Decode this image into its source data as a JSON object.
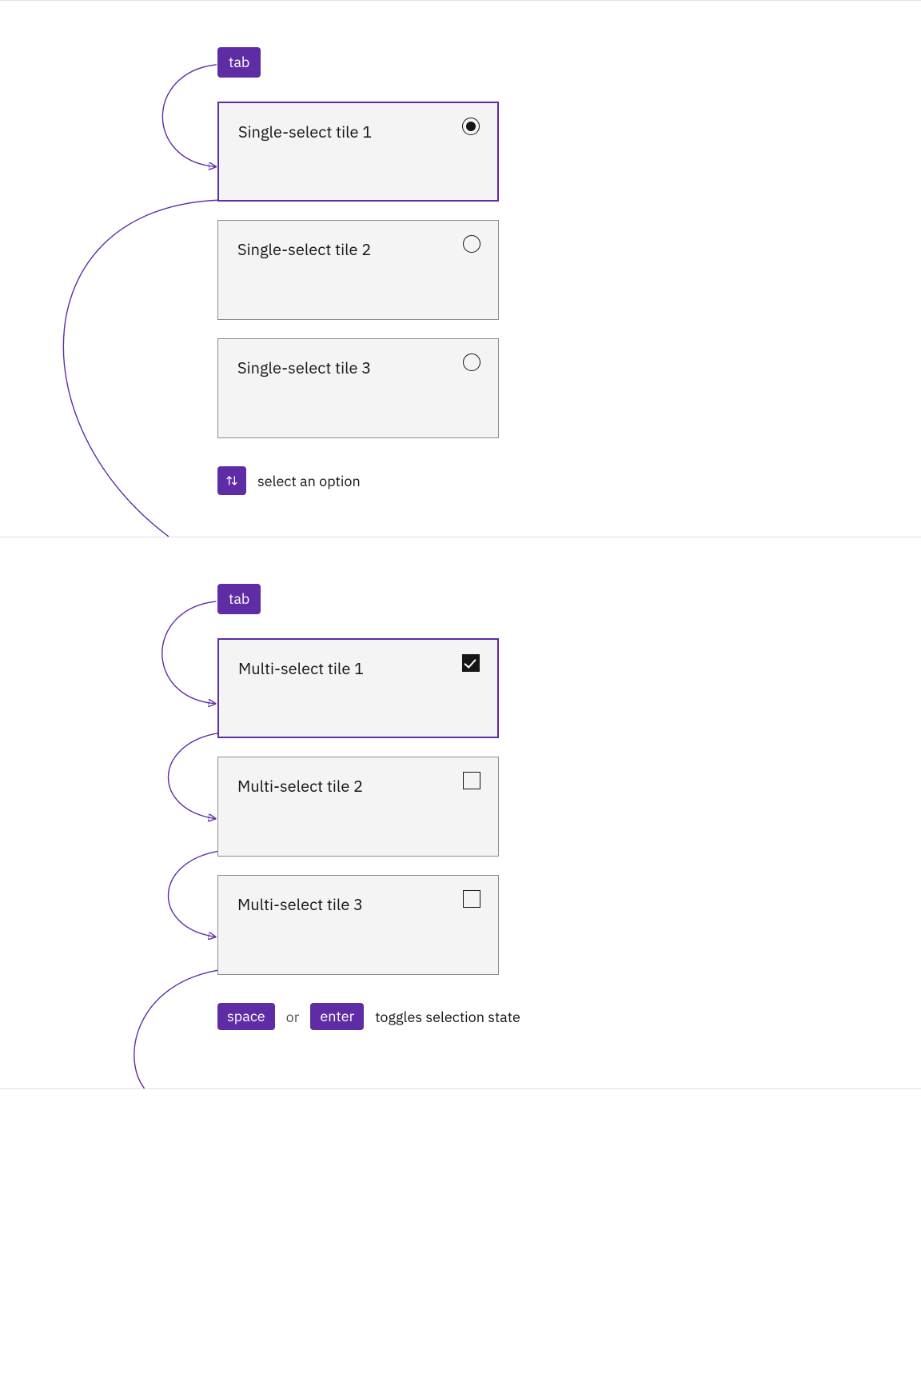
{
  "single": {
    "tabKey": "tab",
    "tiles": [
      {
        "label": "Single-select tile 1",
        "selected": true,
        "focused": true
      },
      {
        "label": "Single-select tile 2",
        "selected": false,
        "focused": false
      },
      {
        "label": "Single-select tile 3",
        "selected": false,
        "focused": false
      }
    ],
    "caption": "select an option"
  },
  "multi": {
    "tabKey": "tab",
    "tiles": [
      {
        "label": "Multi-select tile 1",
        "selected": true,
        "focused": true
      },
      {
        "label": "Multi-select tile 2",
        "selected": false,
        "focused": false
      },
      {
        "label": "Multi-select tile 3",
        "selected": false,
        "focused": false
      }
    ],
    "caption": {
      "key1": "space",
      "sep": "or",
      "key2": "enter",
      "text": "toggles selection state"
    }
  }
}
